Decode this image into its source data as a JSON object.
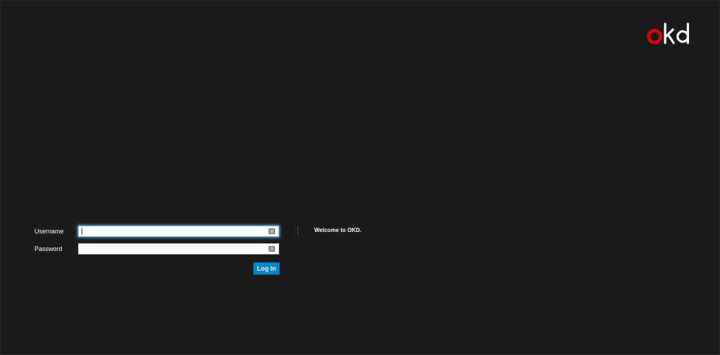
{
  "brand": {
    "logo_text": "okd",
    "accent_color": "#e00000"
  },
  "login_form": {
    "username_label": "Username",
    "username_value": "",
    "password_label": "Password",
    "password_value": "",
    "submit_label": "Log In",
    "button_color": "#0088ce"
  },
  "welcome": {
    "message": "Welcome to OKD."
  },
  "colors": {
    "background": "#1b1b1c"
  },
  "icons": {
    "autofill": "contact-card-icon"
  }
}
